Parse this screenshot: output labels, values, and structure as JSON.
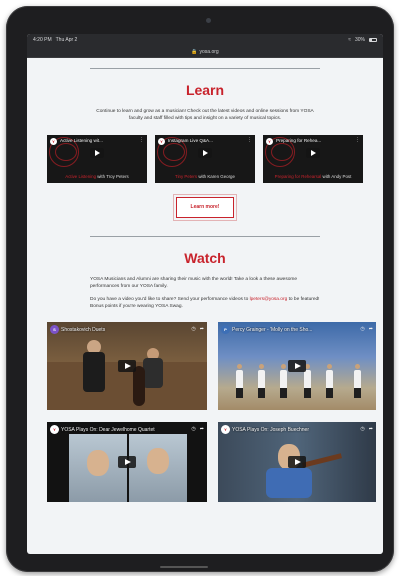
{
  "status_bar": {
    "time": "4:20 PM",
    "date": "Thu Apr 2",
    "battery": "30%"
  },
  "url_bar": {
    "domain": "yosa.org"
  },
  "learn": {
    "heading": "Learn",
    "intro": "Continue to learn and grow as a musician! Check out the latest videos and online sessions from YOSA faculty and staff filled with tips and insight on a variety of musical topics.",
    "cards": [
      {
        "title": "Active Listening wit...",
        "caption_red": "Active Listening",
        "caption_white": " with Troy Peters"
      },
      {
        "title": "Instagram Live Q&A...",
        "caption_red": "Tiny Peters",
        "caption_white": " with Karen George"
      },
      {
        "title": "Preparing for Rehea...",
        "caption_red": "Preparing for Rehearsal",
        "caption_white": " with Andy Post"
      }
    ],
    "button_label": "Learn more!"
  },
  "watch": {
    "heading": "Watch",
    "intro": "YOSA Musicians and Alumni are sharing their music with the world! Take a look a these awesome performances from our YOSA family.",
    "prompt_pre": "Do you have a video you'd like to share? Send your performance videos to ",
    "email": "lpeters@yosa.org",
    "prompt_post": " to be featured! Bonus points if you're wearing YOSA Swag.",
    "videos": [
      {
        "title": "Shostakovich Duets"
      },
      {
        "title": "Percy Grainger - 'Molly on the Sho..."
      },
      {
        "title": "YOSA Plays On: Dear Jewelhome Quartet"
      },
      {
        "title": "YOSA Plays On: Joseph Buechner"
      }
    ]
  },
  "icons": {
    "lock": "lock-icon",
    "wifi": "wifi-icon",
    "battery": "battery-icon",
    "play": "play-icon",
    "kebab": "more-vert-icon",
    "clock": "watch-later-icon",
    "share": "share-icon"
  },
  "colors": {
    "accent": "#c8232c",
    "page_bg": "#f2f4f6",
    "device": "#1e1e20"
  }
}
